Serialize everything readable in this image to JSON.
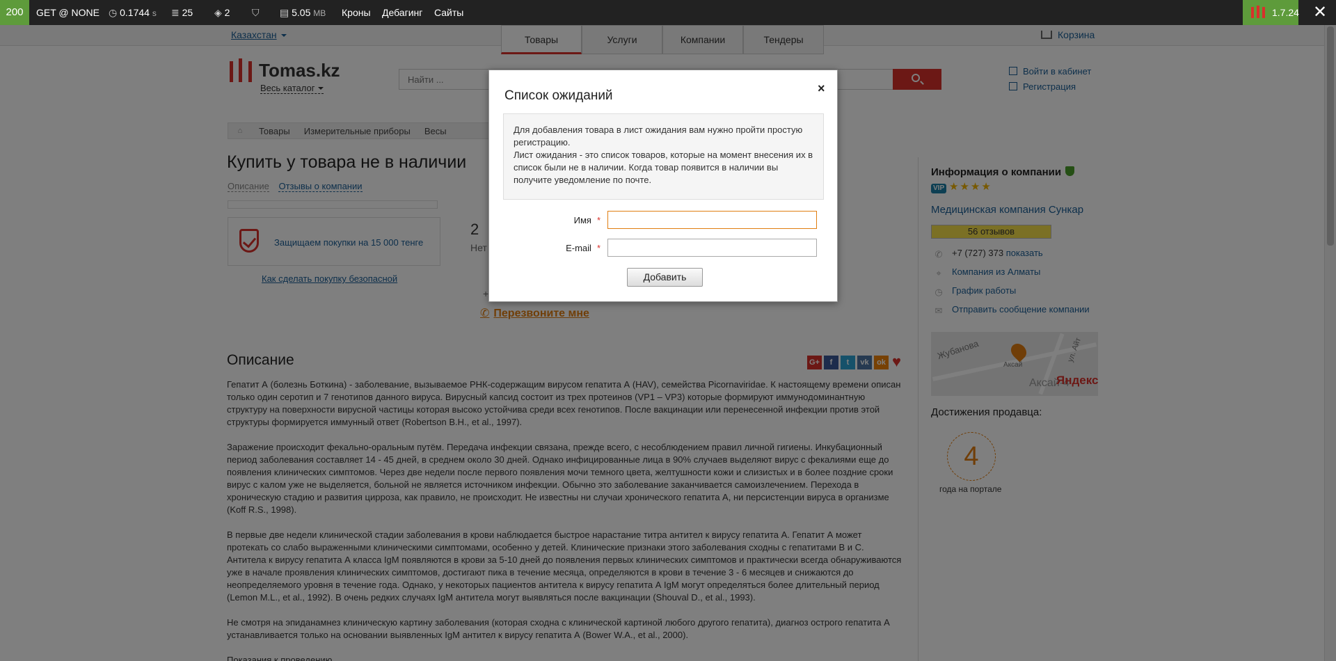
{
  "debugbar": {
    "status": "200",
    "request": "GET @ NONE",
    "time_value": "0.1744",
    "time_unit": "s",
    "queries": "25",
    "cache": "2",
    "memory_value": "5.05",
    "memory_unit": "MB",
    "crons": "Кроны",
    "debugging": "Дебагинг",
    "sites": "Сайты",
    "version": "1.7.24"
  },
  "header": {
    "region": "Казахстан",
    "tabs": [
      "Товары",
      "Услуги",
      "Компании",
      "Тендеры"
    ],
    "cart": "Корзина",
    "logo": "Tomas.kz",
    "catalog": "Весь каталог",
    "search_placeholder": "Найти ...",
    "login": "Войти в кабинет",
    "register": "Регистрация"
  },
  "breadcrumbs": [
    "Товары",
    "Измерительные приборы",
    "Весы"
  ],
  "main": {
    "title": "Купить у товара не в наличии",
    "tab_description": "Описание",
    "tab_reviews": "Отзывы о компании",
    "guard_text": "Защищаем покупки на 15 000 тенге",
    "howto": "Как сделать покупку безопасной",
    "count": "2",
    "count_text": "Нет",
    "plus": "+",
    "callback": "Перезвоните мне",
    "desc_heading": "Описание",
    "paragraphs": [
      "Гепатит А (болезнь Боткина) - заболевание, вызываемое РНК-содержащим вирусом гепатита А (HAV), семейства Picornaviridae. К настоящему времени описан только один серотип и 7 генотипов данного вируса. Вирусный капсид состоит из трех протеинов (VP1 – VP3) которые формируют иммунодоминантную структуру на поверхности вирусной частицы которая высоко устойчива среди всех генотипов. После вакцинации или перенесенной инфекции против этой структуры формируется иммунный ответ (Robertson B.H., et al., 1997).",
      "Заражение происходит фекально-оральным путём. Передача инфекции связана, прежде всего, с несоблюдением правил личной гигиены. Инкубационный период заболевания составляет 14 - 45 дней, в среднем около 30 дней. Однако инфицированные лица в 90% случаев выделяют вирус с фекалиями еще до появления клинических симптомов. Через две недели после первого появления мочи темного цвета, желтушности кожи и слизистых и в более поздние сроки вирус с калом уже не выделяется, больной не является источником инфекции. Обычно это заболевание заканчивается самоизлечением. Перехода в хроническую стадию и развития цирроза, как правило, не происходит. Не известны ни случаи хронического гепатита А, ни персистенции вируса в организме (Koff R.S., 1998).",
      "В первые две недели клинической стадии заболевания в крови наблюдается быстрое нарастание титра антител к вирусу гепатита А. Гепатит А может протекать со слабо выраженными клиническими симптомами, особенно у детей. Клинические признаки этого заболевания сходны с гепатитами В и С. Антитела к вирусу гепатита А класса IgM появляются в крови за 5-10 дней до появления первых клинических симптомов и практически всегда обнаруживаются уже в начале проявления клинических симптомов, достигают пика в течение месяца, определяются в крови в течение 3 - 6 месяцев и снижаются до неопределяемого уровня в течение года. Однако, у некоторых пациентов антитела к вирусу гепатита А IgM могут определяться более длительный период (Lemon M.L., et al., 1992). В очень редких случаях IgM антитела могут выявляться после вакцинации (Shouval D., et al., 1993).",
      "Не смотря на эпиданамнез клиническую картину заболевания (которая сходна с клинической картиной любого другого гепатита), диагноз острого гепатита А устанавливается только на основании выявленных IgM антител к вирусу гепатита А (Bower W.A., et al., 2000).",
      "Показания к проведению"
    ]
  },
  "sidebar": {
    "title": "Информация о компании",
    "vip": "VIP",
    "stars": "★★★★",
    "company": "Медицинская компания Сункар",
    "reviews": "56 отзывов",
    "phone": "+7 (727) 373",
    "show": "показать",
    "city": "Компания из Алматы",
    "schedule": "График работы",
    "message": "Отправить сообщение компании",
    "map_street": "Жубанова",
    "map_district": "Аксай-4",
    "map_label": "Аксай",
    "map_street2": "ул. Айт",
    "map_brand": "Яндекс",
    "achievements": "Достижения продавца:",
    "years": "4",
    "years_text": "года на портале"
  },
  "modal": {
    "title": "Список ожиданий",
    "close": "×",
    "info_1": "Для добавления товара в лист ожидания вам нужно пройти простую регистрацию.",
    "info_2": "Лист ожидания - это список товаров, которые на момент внесения их в список были не в наличии. Когда товар появится в наличии вы получите уведомление по почте.",
    "name_label": "Имя",
    "email_label": "E-mail",
    "required": "*",
    "name_value": "",
    "email_value": "",
    "submit": "Добавить"
  },
  "colors": {
    "accent": "#d9302b",
    "link": "#1a5e96",
    "debug_ok": "#5e9b3b",
    "orange": "#e07d10"
  }
}
